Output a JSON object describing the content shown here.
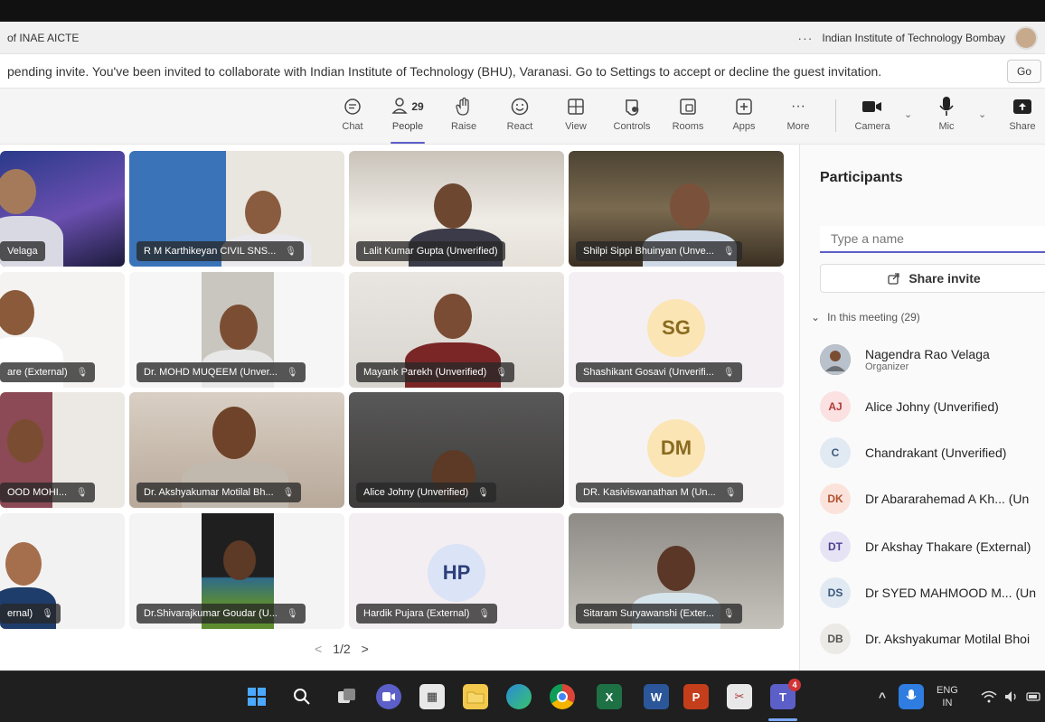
{
  "window": {
    "title": "of INAE AICTE",
    "more": "···",
    "organization": "Indian Institute of Technology Bombay"
  },
  "banner": {
    "text": "pending invite. You've been invited to collaborate with Indian Institute of Technology (BHU), Varanasi. Go to Settings to accept or decline the guest invitation.",
    "go_label": "Go"
  },
  "toolbar": {
    "chat": "Chat",
    "people": "People",
    "people_count": "29",
    "raise": "Raise",
    "react": "React",
    "view": "View",
    "controls": "Controls",
    "rooms": "Rooms",
    "apps": "Apps",
    "more_icon": "···",
    "more": "More",
    "camera": "Camera",
    "mic": "Mic",
    "share": "Share"
  },
  "video_grid": {
    "tiles": [
      {
        "name": "Velaga"
      },
      {
        "name": "R M Karthikeyan CIVIL SNS..."
      },
      {
        "name": "Lalit Kumar Gupta (Unverified)"
      },
      {
        "name": "Shilpi Sippi Bhuinyan (Unve..."
      },
      {
        "name": "are (External)"
      },
      {
        "name": "Dr. MOHD MUQEEM (Unver..."
      },
      {
        "name": "Mayank Parekh (Unverified)"
      },
      {
        "name": "Shashikant Gosavi (Unverifi...",
        "initials": "SG"
      },
      {
        "name": "OOD MOHI..."
      },
      {
        "name": "Dr. Akshyakumar Motilal Bh..."
      },
      {
        "name": "Alice Johny (Unverified)"
      },
      {
        "name": "DR. Kasiviswanathan M (Un...",
        "initials": "DM"
      },
      {
        "name": "ernal)"
      },
      {
        "name": "Dr.Shivarajkumar Goudar (U..."
      },
      {
        "name": "Hardik Pujara (External)",
        "initials": "HP"
      },
      {
        "name": "Sitaram Suryawanshi (Exter..."
      }
    ],
    "pager": "1/2"
  },
  "participants": {
    "title": "Participants",
    "search_placeholder": "Type a name",
    "share_invite": "Share invite",
    "section_label": "In this meeting (29)",
    "list": [
      {
        "initials": "",
        "name": "Nagendra Rao Velaga",
        "role": "Organizer"
      },
      {
        "initials": "AJ",
        "name": "Alice Johny (Unverified)",
        "role": ""
      },
      {
        "initials": "C",
        "name": "Chandrakant (Unverified)",
        "role": ""
      },
      {
        "initials": "DK",
        "name": "Dr Abararahemad A Kh... (Un",
        "role": ""
      },
      {
        "initials": "DT",
        "name": "Dr Akshay Thakare (External)",
        "role": ""
      },
      {
        "initials": "DS",
        "name": "Dr SYED MAHMOOD M... (Un",
        "role": ""
      },
      {
        "initials": "DB",
        "name": "Dr. Akshyakumar Motilal Bhoi",
        "role": ""
      }
    ]
  },
  "taskbar": {
    "language": "ENG",
    "region": "IN",
    "teams_badge": "4"
  },
  "colors": {
    "accent": "#5b5fc7",
    "taskbar": "#1f1f1f",
    "initials_bg_sg": "#fbe5b4",
    "initials_bg_hp": "#dbe3f7"
  }
}
